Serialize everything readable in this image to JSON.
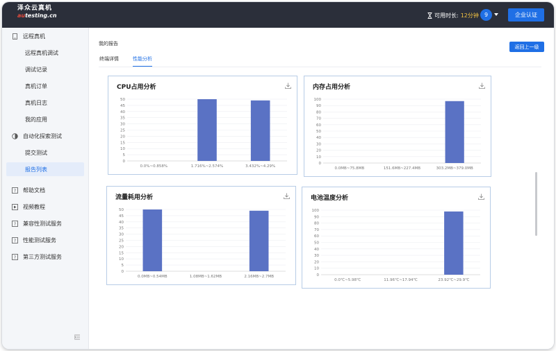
{
  "header": {
    "logo_line1": "泽众云真机",
    "logo_line2_accent": "au",
    "logo_line2_rest": "testing.cn",
    "timer_label": "可用时长:",
    "timer_value": "12分钟",
    "user_badge": "9",
    "enterprise_button": "企业认证"
  },
  "sidebar": {
    "items": [
      {
        "label": "远程真机",
        "icon": "phone-icon",
        "level": 1
      },
      {
        "label": "远程真机调试",
        "level": 2
      },
      {
        "label": "调试记录",
        "level": 2
      },
      {
        "label": "真机订单",
        "level": 2
      },
      {
        "label": "真机日志",
        "level": 2
      },
      {
        "label": "我的应用",
        "level": 2
      },
      {
        "label": "自动化探索测试",
        "icon": "explore-icon",
        "level": 1
      },
      {
        "label": "提交测试",
        "level": 2
      },
      {
        "label": "报告列表",
        "level": 2,
        "active": true
      },
      {
        "label": "帮助文档",
        "icon": "help-icon",
        "level": 1
      },
      {
        "label": "视频教程",
        "icon": "video-icon",
        "level": 1
      },
      {
        "label": "兼容性测试服务",
        "icon": "help-icon",
        "level": 1
      },
      {
        "label": "性能测试服务",
        "icon": "help-icon",
        "level": 1
      },
      {
        "label": "第三方测试服务",
        "icon": "help-icon",
        "level": 1
      }
    ]
  },
  "main": {
    "breadcrumb": "我的报告",
    "back_button": "返回上一级",
    "tabs": [
      {
        "label": "终端详情",
        "active": false
      },
      {
        "label": "性能分析",
        "active": true
      }
    ]
  },
  "colors": {
    "accent": "#1f6fe5",
    "bar": "#5a72c4",
    "topbar": "#2b2f3a",
    "highlight": "#f5c542"
  },
  "chart_data": [
    {
      "type": "bar",
      "title": "CPU占用分析",
      "categories": [
        "0.0%~0.858%",
        "1.716%~2.574%",
        "3.432%~4.29%"
      ],
      "values": [
        0,
        50,
        49
      ],
      "yticks": [
        0,
        5,
        10,
        15,
        20,
        25,
        30,
        35,
        40,
        45,
        50
      ],
      "ylim": [
        0,
        50
      ]
    },
    {
      "type": "bar",
      "title": "内存占用分析",
      "categories": [
        "0.0MB~75.8MB",
        "151.6MB~227.4MB",
        "303.2MB~379.0MB"
      ],
      "values": [
        0,
        0,
        97
      ],
      "yticks": [
        0,
        10,
        20,
        30,
        40,
        50,
        60,
        70,
        80,
        90,
        100
      ],
      "ylim": [
        0,
        100
      ]
    },
    {
      "type": "bar",
      "title": "流量耗用分析",
      "categories": [
        "0.0MB~0.54MB",
        "1.08MB~1.62MB",
        "2.16MB~2.7MB"
      ],
      "values": [
        50,
        0,
        49
      ],
      "yticks": [
        0,
        5,
        10,
        15,
        20,
        25,
        30,
        35,
        40,
        45,
        50
      ],
      "ylim": [
        0,
        50
      ]
    },
    {
      "type": "bar",
      "title": "电池温度分析",
      "categories": [
        "0.0℃~5.98℃",
        "11.96℃~17.94℃",
        "23.92℃~29.9℃"
      ],
      "values": [
        0,
        0,
        98
      ],
      "yticks": [
        0,
        10,
        20,
        30,
        40,
        50,
        60,
        70,
        80,
        90,
        100
      ],
      "ylim": [
        0,
        100
      ]
    }
  ]
}
